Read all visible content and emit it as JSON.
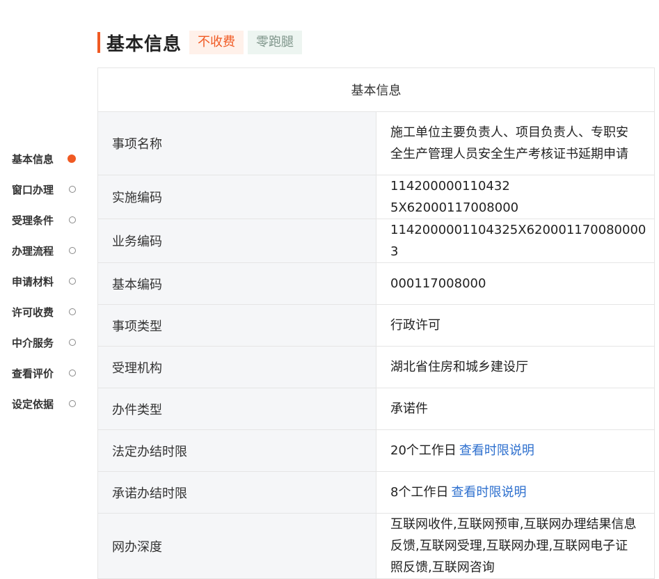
{
  "header": {
    "title": "基本信息",
    "badges": [
      "不收费",
      "零跑腿"
    ]
  },
  "side_nav": [
    {
      "label": "基本信息",
      "active": true
    },
    {
      "label": "窗口办理",
      "active": false
    },
    {
      "label": "受理条件",
      "active": false
    },
    {
      "label": "办理流程",
      "active": false
    },
    {
      "label": "申请材料",
      "active": false
    },
    {
      "label": "许可收费",
      "active": false
    },
    {
      "label": "中介服务",
      "active": false
    },
    {
      "label": "查看评价",
      "active": false
    },
    {
      "label": "设定依据",
      "active": false
    }
  ],
  "table": {
    "caption": "基本信息",
    "rows": [
      {
        "label": "事项名称",
        "value": "施工单位主要负责人、项目负责人、专职安全生产管理人员安全生产考核证书延期申请"
      },
      {
        "label": "实施编码",
        "value": "114200000110432 5X62000117008000"
      },
      {
        "label": "业务编码",
        "value": "1142000001104325X620001170080000 3"
      },
      {
        "label": "基本编码",
        "value": "000117008000"
      },
      {
        "label": "事项类型",
        "value": "行政许可"
      },
      {
        "label": "受理机构",
        "value": "湖北省住房和城乡建设厅"
      },
      {
        "label": "办件类型",
        "value": "承诺件"
      },
      {
        "label": "法定办结时限",
        "value": "20个工作日",
        "link": "查看时限说明"
      },
      {
        "label": "承诺办结时限",
        "value": "8个工作日",
        "link": "查看时限说明"
      },
      {
        "label": "网办深度",
        "value": "互联网收件,互联网预审,互联网办理结果信息反馈,互联网受理,互联网办理,互联网电子证照反馈,互联网咨询"
      }
    ]
  },
  "colors": {
    "accent": "#f05a23",
    "link": "#2d6fce",
    "label_bg": "#f5f6f8"
  }
}
